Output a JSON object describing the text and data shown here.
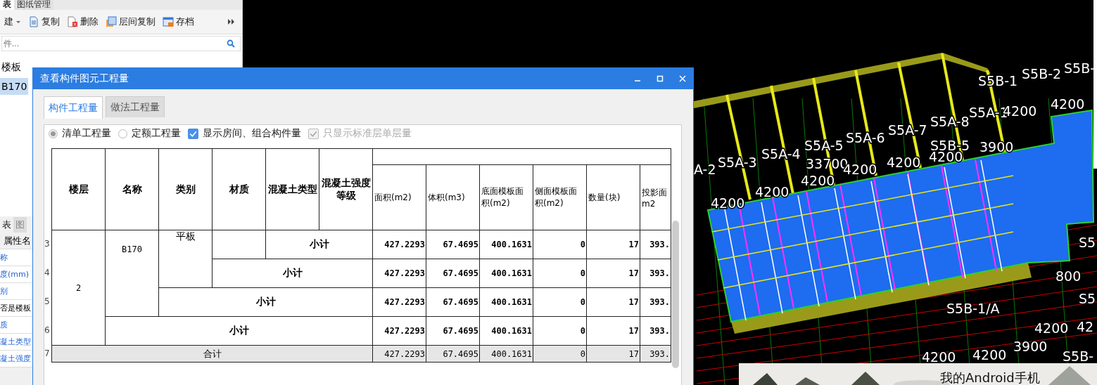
{
  "left_panel": {
    "tabs": [
      {
        "label": "表",
        "selected": true
      },
      {
        "label": "图纸管理",
        "selected": false
      }
    ],
    "toolbar": [
      {
        "label": "建",
        "kind": "new"
      },
      {
        "label": "复制",
        "kind": "copy"
      },
      {
        "label": "删除",
        "kind": "delete"
      },
      {
        "label": "层间复制",
        "kind": "floorcopy"
      },
      {
        "label": "存档",
        "kind": "archive"
      }
    ],
    "search": {
      "placeholder": "件..."
    },
    "tree": [
      {
        "label": "楼板",
        "selected": false
      },
      {
        "label": "B170",
        "selected": true
      }
    ],
    "lower_tabs": [
      {
        "label": "表",
        "selected": true
      },
      {
        "label": "图",
        "selected": false
      }
    ],
    "property_header": "属性名",
    "properties": [
      {
        "label": "称",
        "public": true
      },
      {
        "label": "度(mm)",
        "public": true
      },
      {
        "label": "别",
        "public": true
      },
      {
        "label": "否是楼板",
        "public": false
      },
      {
        "label": "质",
        "public": true
      },
      {
        "label": "凝土类型",
        "public": true
      },
      {
        "label": "凝土强度",
        "public": true
      }
    ]
  },
  "dialog": {
    "title": "查看构件图元工程量",
    "tabs": [
      {
        "label": "构件工程量",
        "selected": true
      },
      {
        "label": "做法工程量",
        "selected": false
      }
    ],
    "options": [
      {
        "kind": "radio",
        "label": "清单工程量",
        "selected": true
      },
      {
        "kind": "radio",
        "label": "定额工程量",
        "selected": false
      },
      {
        "kind": "checkbox",
        "label": "显示房间、组合构件量",
        "checked": true,
        "disabled": false
      },
      {
        "kind": "checkbox",
        "label": "只显示标准层单层量",
        "checked": true,
        "disabled": true
      }
    ],
    "table": {
      "columns": [
        "楼层",
        "名称",
        "类别",
        "材质",
        "混凝土类型",
        "混凝土强度等级",
        "面积(m2)",
        "体积(m3)",
        "底面模板面积(m2)",
        "侧面模板面积(m2)",
        "数量(块)",
        "投影面m2"
      ],
      "floor": "2",
      "name": "B170",
      "category": "平板",
      "rows": [
        {
          "number": "3",
          "label": "小计",
          "values": [
            "427.2293",
            "67.4695",
            "400.1631",
            "0",
            "17",
            "393."
          ]
        },
        {
          "number": "4",
          "label": "小计",
          "values": [
            "427.2293",
            "67.4695",
            "400.1631",
            "0",
            "17",
            "393."
          ]
        },
        {
          "number": "5",
          "label": "小计",
          "values": [
            "427.2293",
            "67.4695",
            "400.1631",
            "0",
            "17",
            "393."
          ]
        },
        {
          "number": "6",
          "label": "小计",
          "values": [
            "427.2293",
            "67.4695",
            "400.1631",
            "0",
            "17",
            "393."
          ]
        }
      ],
      "total": {
        "number": "7",
        "label": "合计",
        "values": [
          "427.2293",
          "67.4695",
          "400.1631",
          "0",
          "17",
          "393."
        ]
      }
    }
  },
  "viewport": {
    "labels": [
      "S5B-1",
      "S5B-2",
      "S5B-",
      "S5A-1",
      "4200",
      "4200",
      "S5A-7",
      "S5A-8",
      "S5B-5",
      "3900",
      "S5A-6",
      "S5A-5",
      "S5A-4",
      "S5A-3",
      "A-2",
      "33700",
      "4200",
      "4200",
      "4200",
      "4200",
      "4200",
      "4200",
      "S5",
      "S5",
      "S5B-1/A",
      "800",
      "4200",
      "42",
      "4200",
      "4200",
      "3900",
      "S5B-"
    ],
    "notification": "我的Android手机"
  }
}
